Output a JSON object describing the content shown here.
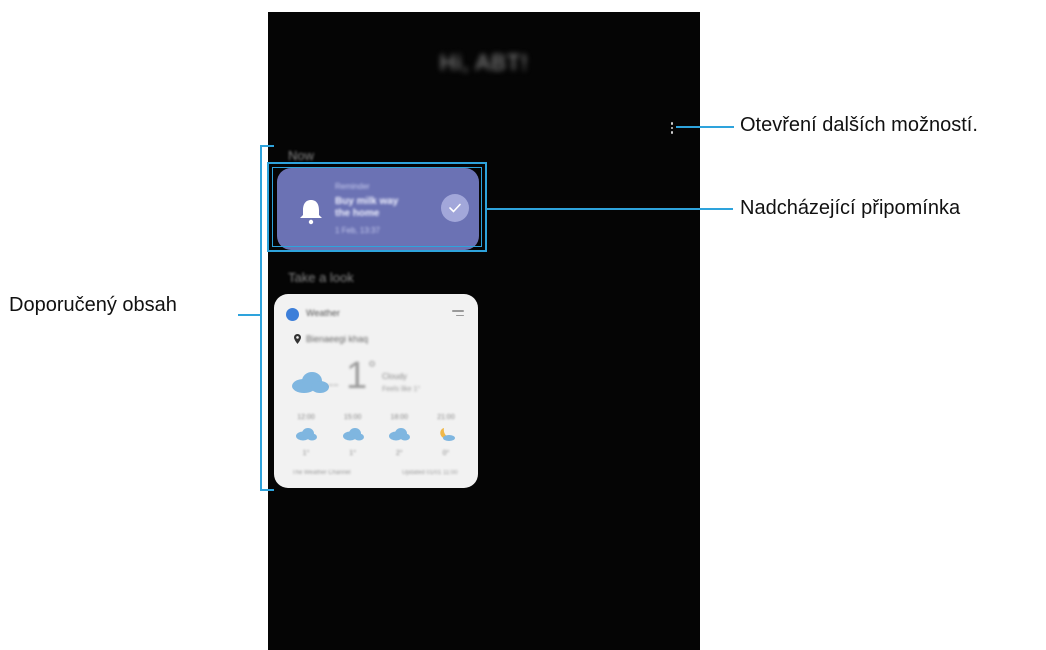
{
  "callouts": {
    "more_options": "Otevření dalších možností.",
    "upcoming_reminder": "Nadcházející připomínka",
    "recommended_content": "Doporučený obsah"
  },
  "screen": {
    "greeting": "Hi, ABT!",
    "now_section": "Now",
    "take_a_look_section": "Take a look",
    "reminder": {
      "category": "Reminder",
      "title": "Buy milk way the home",
      "time": "1 Feb, 13:37"
    },
    "weather": {
      "app_name": "Weather",
      "location": "Bienaeegi khaq",
      "dash": "−−",
      "temperature": "1",
      "degree": "°",
      "condition": "Cloudy",
      "high_low": "Feels like 1°",
      "hourly": [
        {
          "time": "12:00",
          "icon": "cloud-icon",
          "temp": "1°"
        },
        {
          "time": "15:00",
          "icon": "cloud-icon",
          "temp": "1°"
        },
        {
          "time": "18:00",
          "icon": "cloud-icon",
          "temp": "2°"
        },
        {
          "time": "21:00",
          "icon": "moon-cloud-icon",
          "temp": "0°"
        }
      ],
      "source": "The Weather Channel",
      "updated": "Updated 01/01 11:00"
    }
  },
  "colors": {
    "accent": "#2ea3dc",
    "reminder_card": "#6b72b4",
    "weather_card": "#f2f2f2",
    "screen_background": "#050505"
  }
}
